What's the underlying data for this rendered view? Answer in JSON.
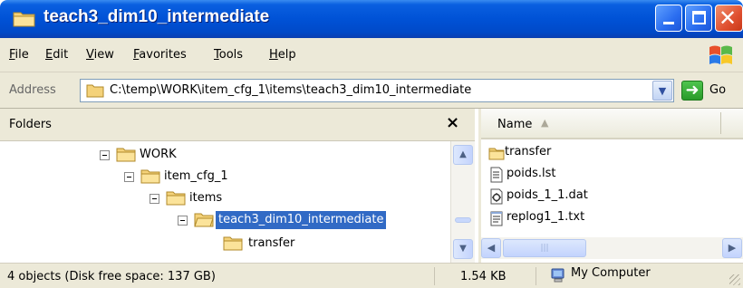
{
  "window": {
    "title": "teach3_dim10_intermediate",
    "accent": "#0052d6"
  },
  "menu": [
    "File",
    "Edit",
    "View",
    "Favorites",
    "Tools",
    "Help"
  ],
  "address": {
    "label": "Address",
    "value": "C:\\temp\\WORK\\item_cfg_1\\items\\teach3_dim10_intermediate",
    "go_label": "Go"
  },
  "folders": {
    "title": "Folders",
    "close_glyph": "×",
    "tree": [
      {
        "label": "WORK",
        "expanded": true,
        "selected": false
      },
      {
        "label": "item_cfg_1",
        "expanded": true,
        "selected": false
      },
      {
        "label": "items",
        "expanded": true,
        "selected": false
      },
      {
        "label": "teach3_dim10_intermediate",
        "expanded": true,
        "selected": true
      },
      {
        "label": "transfer",
        "expanded": false,
        "selected": false
      }
    ]
  },
  "files": {
    "column_name": "Name",
    "items": [
      {
        "label": "transfer",
        "icon": "folder-icon"
      },
      {
        "label": "poids.lst",
        "icon": "list-file-icon"
      },
      {
        "label": "poids_1_1.dat",
        "icon": "data-file-icon"
      },
      {
        "label": "replog1_1.txt",
        "icon": "text-file-icon"
      }
    ]
  },
  "status": {
    "objects": "4 objects (Disk free space: 137 GB)",
    "size": "1.54 KB",
    "location": "My Computer"
  }
}
